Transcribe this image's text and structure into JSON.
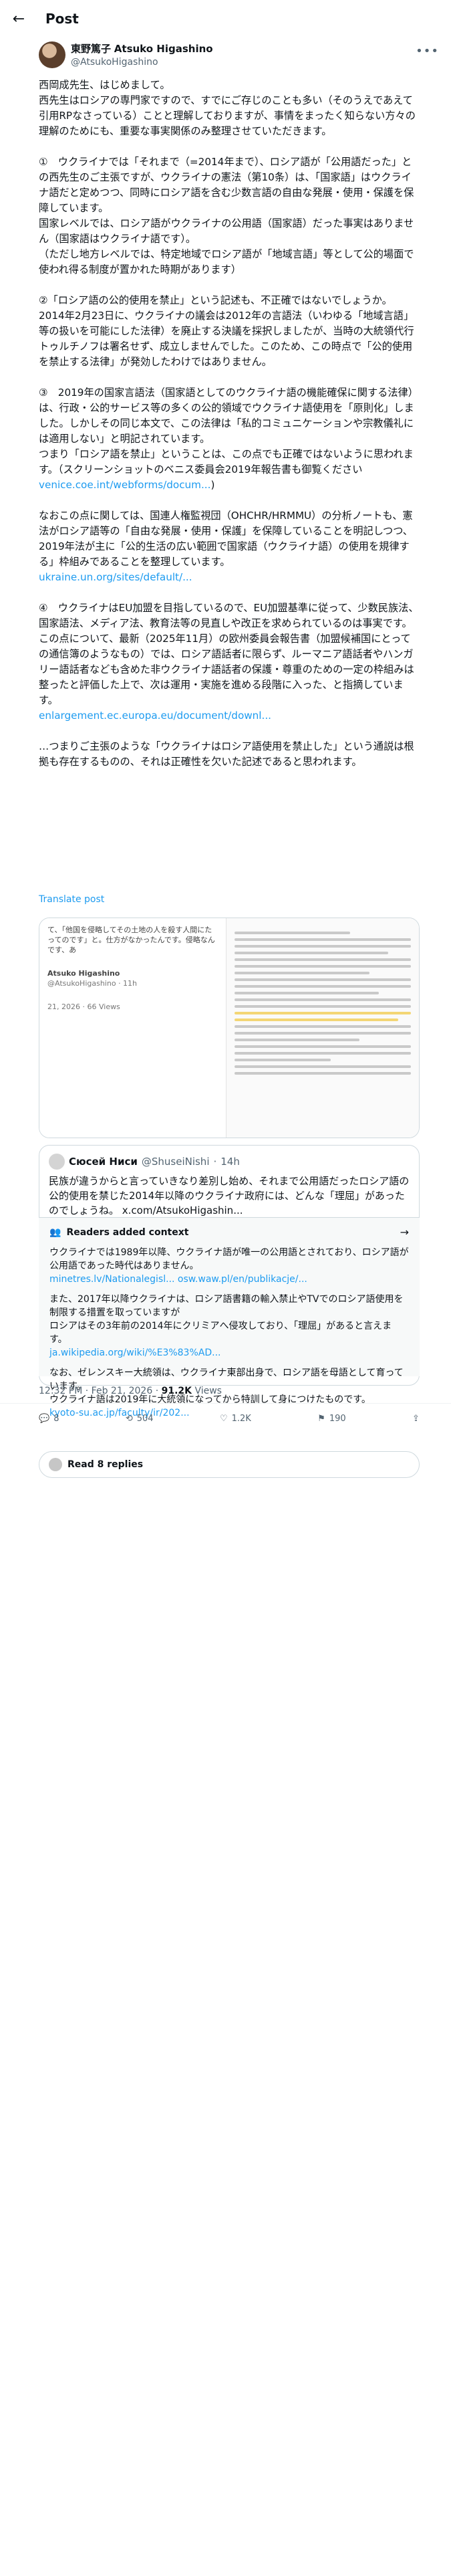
{
  "header": {
    "title": "Post",
    "back_icon": "arrow-left-icon"
  },
  "author": {
    "display_name": "東野篤子",
    "name_en": "Atsuko Higashino",
    "handle": "@AtsukoHigashino"
  },
  "tweet": {
    "lines": [
      "西岡成先生、はじめまして。",
      "西先生はロシアの専門家ですので、すでにご存じのことも多い（そのうえであえて引用RPなさっている）ことと理解しておりますが、事情をまったく知らない方々の理解のためにも、重要な事実関係のみ整理させていただきます。",
      "",
      "①　ウクライナでは「それまで（=2014年まで）、ロシア語が「公用語だった」との西先生のご主張ですが、ウクライナの憲法（第10条）は、「国家語」はウクライナ語だと定めつつ、同時にロシア語を含む少数言語の自由な発展・使用・保護を保障しています。",
      "国家レベルでは、ロシア語がウクライナの公用語（国家語）だった事実はありません（国家語はウクライナ語です）。",
      "（ただし地方レベルでは、特定地域でロシア語が「地域言語」等として公的場面で使われ得る制度が置かれた時期があります）",
      "",
      "②「ロシア語の公的使用を禁止」という記述も、不正確ではないでしょうか。",
      "2014年2月23日に、ウクライナの議会は2012年の言語法（いわゆる「地域言語」等の扱いを可能にした法律）を廃止する決議を採択しましたが、当時の大統領代行トゥルチノフは署名せず、成立しませんでした。このため、この時点で「公的使用を禁止する法律」が発効したわけではありません。",
      "",
      "③　2019年の国家言語法（国家語としてのウクライナ語の機能確保に関する法律）は、行政・公的サービス等の多くの公的領域でウクライナ語使用を「原則化」しました。しかしその同じ本文で、この法律は「私的コミュニケーションや宗教儀礼には適用しない」と明記されています。",
      "つまり「ロシア語を禁止」ということは、この点でも正確ではないように思われます。（スクリーンショットのベニス委員会2019年報告書も御覧ください"
    ],
    "link1": "venice.coe.int/webforms/docum...",
    "lines2": [
      "なおこの点に関しては、国連人権監視団（OHCHR/HRMMU）の分析ノートも、憲法がロシア語等の「自由な発展・使用・保護」を保障していることを明記しつつ、2019年法が主に「公的生活の広い範囲で国家語（ウクライナ語）の使用を規律する」枠組みであることを整理しています。"
    ],
    "link2": "ukraine.un.org/sites/default/...",
    "lines3": [
      "④　ウクライナはEU加盟を目指しているので、EU加盟基準に従って、少数民族法、国家語法、メディア法、教育法等の見直しや改正を求められているのは事実です。",
      "この点について、最新（2025年11月）の欧州委員会報告書（加盟候補国にとっての通信簿のようなもの）では、ロシア語話者に限らず、ルーマニア語話者やハンガリー語話者なども含めた非ウクライナ語話者の保護・尊重のための一定の枠組みは整ったと評価した上で、次は運用・実施を進める段階に入った、と指摘しています。"
    ],
    "link3": "enlargement.ec.europa.eu/document/downl...",
    "closing": "…つまりご主張のような「ウクライナはロシア語使用を禁止した」という通説は根拠も存在するものの、それは正確性を欠いた記述であると思われます。"
  },
  "translate_label": "Translate post",
  "quote": {
    "author": "Сюсей Ниси",
    "handle": "@ShuseiNishi",
    "time": "14h",
    "text": "民族が違うからと言っていきなり差別し始め、それまで公用語だったロシア語の公的使用を禁じた2014年以降のウクライナ政府には、どんな「理屈」があったのでしょうね。 x.com/AtsukoHigashin..."
  },
  "embedded_quote": {
    "name": "Atsuko Higashino",
    "handle": "@AtsukoHigashino · 11h",
    "snippet": "て、「他国を侵略してその土地の人を殺す人間にたってのです」と。仕方がなかったんです。侵略なんです、あ",
    "date": "21, 2026",
    "views": "66 Views"
  },
  "community_note": {
    "title": "Readers added context",
    "body1": "ウクライナでは1989年以降、ウクライナ語が唯一の公用語とされており、ロシア語が公用語であった時代はありません。",
    "link1": "minetres.lv/Nationalegisl... osw.waw.pl/en/publikacje/...",
    "body2": "また、2017年以降ウクライナは、ロシア語書籍の輸入禁止やTVでのロシア語使用を制限する措置を取っていますが\nロシアはその3年前の2014年にクリミアへ侵攻しており、「理屈」があると言えます。",
    "link2": "ja.wikipedia.org/wiki/%E3%83%AD...",
    "body3": "なお、ゼレンスキー大統領は、ウクライナ東部出身で、ロシア語を母語として育っています。\nウクライナ語は2019年に大統領になってから特訓して身につけたものです。",
    "link3": "kyoto-su.ac.jp/faculty/ir/202..."
  },
  "meta": {
    "time": "12:32 PM · Feb 21, 2026 · ",
    "views_count": "91.2K",
    "views_label": " Views"
  },
  "actions": {
    "replies": "8",
    "reposts": "504",
    "likes": "1.2K",
    "bookmarks": "190"
  },
  "read_replies": "Read 8 replies"
}
